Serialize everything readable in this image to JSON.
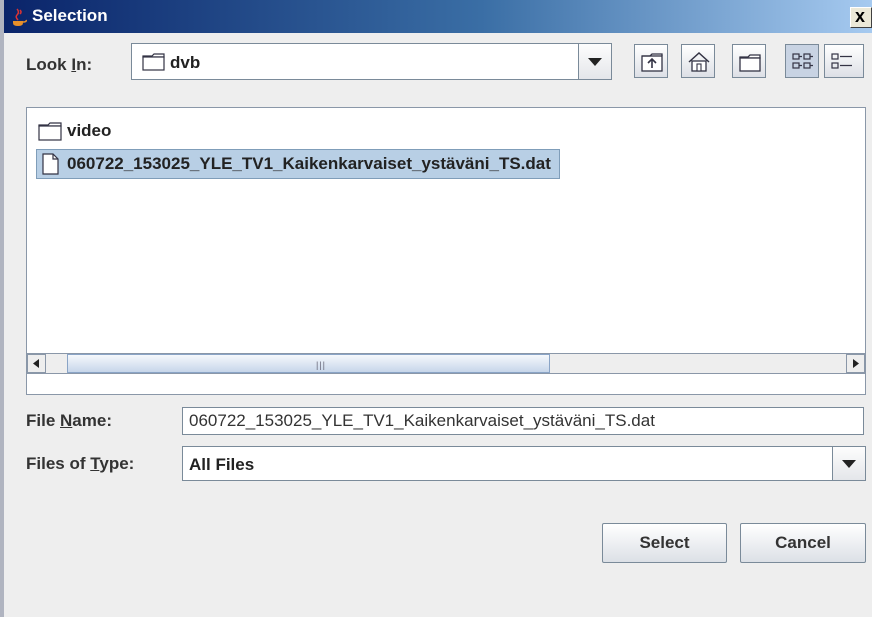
{
  "window": {
    "title": "Selection",
    "close_glyph": "x"
  },
  "lookin": {
    "label_prefix": "Look ",
    "label_mnemonic": "I",
    "label_suffix": "n:",
    "value": "dvb"
  },
  "toolbar": {
    "icons": [
      "up-folder-icon",
      "home-icon",
      "new-folder-icon",
      "list-view-icon",
      "details-view-icon"
    ]
  },
  "files": [
    {
      "name": "video",
      "type": "folder",
      "selected": false
    },
    {
      "name": "060722_153025_YLE_TV1_Kaikenkarvaiset_ystäväni_TS.dat",
      "type": "file",
      "selected": true
    }
  ],
  "filename": {
    "label_prefix": "File ",
    "label_mnemonic": "N",
    "label_suffix": "ame:",
    "value": "060722_153025_YLE_TV1_Kaikenkarvaiset_ystäväni_TS.dat"
  },
  "filetype": {
    "label_prefix": "Files of ",
    "label_mnemonic": "T",
    "label_suffix": "ype:",
    "value": "All Files"
  },
  "buttons": {
    "select": "Select",
    "cancel": "Cancel"
  },
  "scrollbar": {
    "grip": "|||"
  }
}
